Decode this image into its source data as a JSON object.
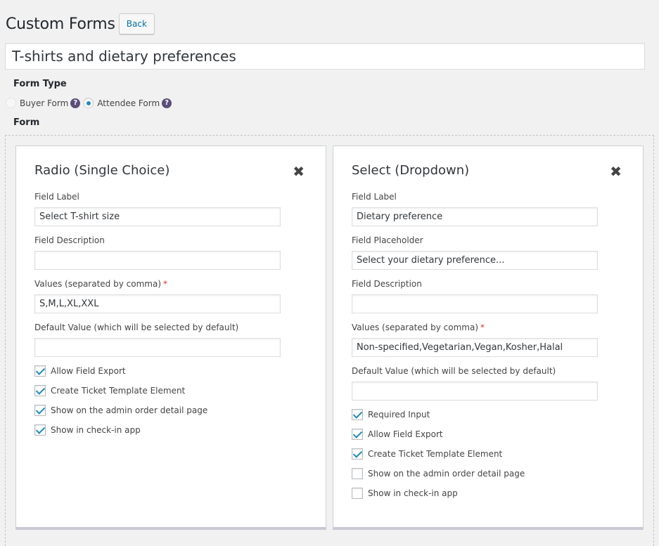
{
  "header": {
    "title": "Custom Forms",
    "back_label": "Back"
  },
  "form_title": "T-shirts and dietary preferences",
  "form_type": {
    "label": "Form Type",
    "options": [
      {
        "label": "Buyer Form",
        "selected": false
      },
      {
        "label": "Attendee Form",
        "selected": true
      }
    ]
  },
  "form_label": "Form",
  "left_card": {
    "title": "Radio (Single Choice)",
    "close_symbol": "✖",
    "fields": {
      "label_label": "Field Label",
      "label_value": "Select T-shirt size",
      "description_label": "Field Description",
      "description_value": "",
      "values_label": "Values (separated by comma)",
      "values_value": "S,M,L,XL,XXL",
      "default_label": "Default Value (which will be selected by default)",
      "default_value": ""
    },
    "checkboxes": [
      {
        "label": "Allow Field Export",
        "checked": true
      },
      {
        "label": "Create Ticket Template Element",
        "checked": true
      },
      {
        "label": "Show on the admin order detail page",
        "checked": true
      },
      {
        "label": "Show in check-in app",
        "checked": true
      }
    ]
  },
  "right_card": {
    "title": "Select (Dropdown)",
    "close_symbol": "✖",
    "fields": {
      "label_label": "Field Label",
      "label_value": "Dietary preference",
      "placeholder_label": "Field Placeholder",
      "placeholder_value": "Select your dietary preference...",
      "description_label": "Field Description",
      "description_value": "",
      "values_label": "Values (separated by comma)",
      "values_value": "Non-specified,Vegetarian,Vegan,Kosher,Halal",
      "default_label": "Default Value (which will be selected by default)",
      "default_value": ""
    },
    "checkboxes": [
      {
        "label": "Required Input",
        "checked": true
      },
      {
        "label": "Allow Field Export",
        "checked": true
      },
      {
        "label": "Create Ticket Template Element",
        "checked": true
      },
      {
        "label": "Show on the admin order detail page",
        "checked": false
      },
      {
        "label": "Show in check-in app",
        "checked": false
      }
    ]
  },
  "required_mark": "*",
  "help_symbol": "?",
  "colors": {
    "accent": "#0073aa",
    "check": "#1e8cbe",
    "required": "#dc3232",
    "help_icon": "#5b4e7a"
  }
}
